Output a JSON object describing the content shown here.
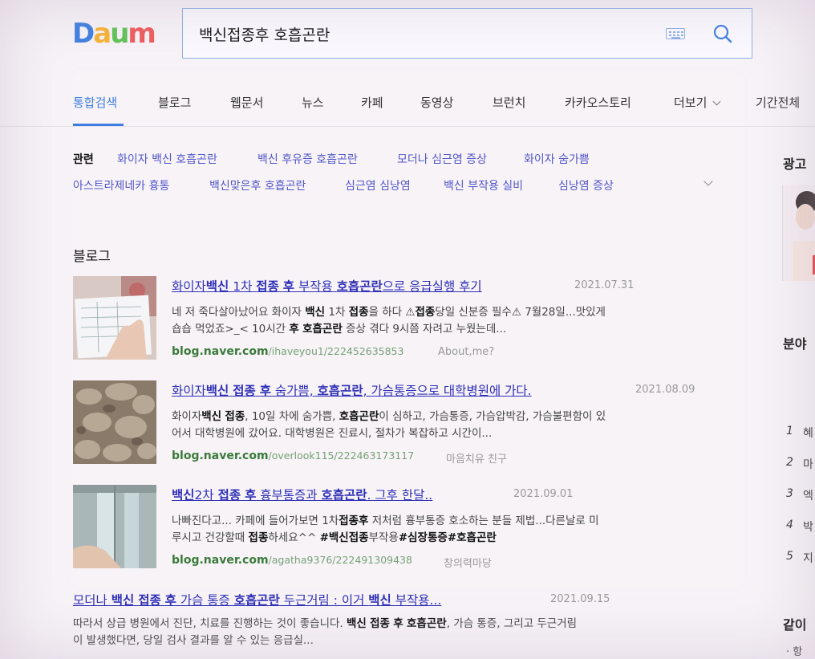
{
  "logo": {
    "letters": [
      "D",
      "a",
      "u",
      "m"
    ],
    "colors": [
      "#3d7ee0",
      "#f7b232",
      "#5fc255",
      "#ef5a5a"
    ]
  },
  "search": {
    "query": "백신접종후 호흡곤란"
  },
  "tabs": [
    "통합검색",
    "블로그",
    "웹문서",
    "뉴스",
    "카페",
    "동영상",
    "브런치",
    "카카오스토리",
    "더보기",
    "기간전체"
  ],
  "related": {
    "label": "관련",
    "row1": [
      "화이자 백신 호흡곤란",
      "백신 후유증 호흡곤란",
      "모더나 심근염 증상",
      "화이자 숨가쁨"
    ],
    "row2": [
      "아스트라제네카 흉통",
      "백신맞은후 호흡곤란",
      "심근염 심낭염",
      "백신 부작용 실비",
      "심낭염 증상"
    ]
  },
  "blog": {
    "section_title": "블로그",
    "results": [
      {
        "title_parts": [
          [
            "화이자",
            false
          ],
          [
            "백신",
            true
          ],
          [
            " 1차 ",
            false
          ],
          [
            "접종",
            true
          ],
          [
            " ",
            false
          ],
          [
            "후",
            true
          ],
          [
            " 부작용 ",
            false
          ],
          [
            "호흡곤란",
            true
          ],
          [
            "으로 응급실행 후기",
            false
          ]
        ],
        "date": "2021.07.31",
        "desc_line1": [
          [
            "네 저 죽다살아났어요 화이자 ",
            false
          ],
          [
            "백신",
            true
          ],
          [
            " 1차 ",
            false
          ],
          [
            "접종",
            true
          ],
          [
            "을 하다 ⚠",
            false
          ],
          [
            "접종",
            true
          ],
          [
            "당일 신분증 필수⚠ 7월28일...맛있게",
            false
          ]
        ],
        "desc_line2": [
          [
            "숍숍 먹었죠>_< 10시간 ",
            false
          ],
          [
            "후",
            true
          ],
          [
            " ",
            false
          ],
          [
            "호흡곤란",
            true
          ],
          [
            " 증상 겪다 9시쯤 자려고 누웠는데...",
            false
          ]
        ],
        "url_domain": "blog.naver.com",
        "url_path": "/ihaveyou1/222452635853",
        "source": "About,me?"
      },
      {
        "title_parts": [
          [
            "화이자",
            false
          ],
          [
            "백신",
            true
          ],
          [
            " ",
            false
          ],
          [
            "접종",
            true
          ],
          [
            " ",
            false
          ],
          [
            "후",
            true
          ],
          [
            " 숨가쁨, ",
            false
          ],
          [
            "호흡곤란",
            true
          ],
          [
            ", 가슴통증으로 대학병원에 가다.",
            false
          ]
        ],
        "date": "2021.08.09",
        "desc_line1": [
          [
            "화이자",
            false
          ],
          [
            "백신",
            true
          ],
          [
            " ",
            false
          ],
          [
            "접종",
            true
          ],
          [
            ", 10일 차에 숨가쁨, ",
            false
          ],
          [
            "호흡곤란",
            true
          ],
          [
            "이 심하고, 가슴통증, 가슴압박감, 가슴불편함이 있",
            false
          ]
        ],
        "desc_line2": [
          [
            "어서 대학병원에 갔어요. 대학병원은 진료시, 절차가 복잡하고 시간이...",
            false
          ]
        ],
        "url_domain": "blog.naver.com",
        "url_path": "/overlook115/222463173117",
        "source": "마음치유 친구"
      },
      {
        "title_parts": [
          [
            "백신",
            true
          ],
          [
            "2차 ",
            false
          ],
          [
            "접종",
            true
          ],
          [
            " ",
            false
          ],
          [
            "후",
            true
          ],
          [
            " 흉부통증과 ",
            false
          ],
          [
            "호흡곤란",
            true
          ],
          [
            ". 그후 한달..",
            false
          ]
        ],
        "date": "2021.09.01",
        "desc_line1": [
          [
            "나빠진다고...   카페에 들어가보면 1차",
            false
          ],
          [
            "접종후",
            true
          ],
          [
            " 저처럼 흉부통증 호소하는 분들 제법...다른날로 미",
            false
          ]
        ],
        "desc_line2": [
          [
            "루시고 건강할때 ",
            false
          ],
          [
            "접종",
            true
          ],
          [
            "하세요^^    ",
            false
          ],
          [
            "#백신접종",
            true
          ],
          [
            "부작용",
            false
          ],
          [
            "#심장통증",
            true
          ],
          [
            "",
            false
          ],
          [
            "#호흡곤란",
            true
          ]
        ],
        "url_domain": "blog.naver.com",
        "url_path": "/agatha9376/222491309438",
        "source": "창의력마당"
      },
      {
        "title_parts": [
          [
            "모더나 ",
            false
          ],
          [
            "백신",
            true
          ],
          [
            " ",
            false
          ],
          [
            "접종",
            true
          ],
          [
            " ",
            false
          ],
          [
            "후",
            true
          ],
          [
            " 가슴 통증 ",
            false
          ],
          [
            "호흡곤란",
            true
          ],
          [
            " 두근거림 : 이거 ",
            false
          ],
          [
            "백신",
            true
          ],
          [
            " 부작용...",
            false
          ]
        ],
        "date": "2021.09.15",
        "desc_line1": [
          [
            "따라서 상급 병원에서 진단, 치료를 진행하는 것이 좋습니다. ",
            false
          ],
          [
            "백신",
            true
          ],
          [
            " ",
            false
          ],
          [
            "접종",
            true
          ],
          [
            " ",
            false
          ],
          [
            "후",
            true
          ],
          [
            " ",
            false
          ],
          [
            "호흡곤란",
            true
          ],
          [
            ", 가슴 통증, 그리고 두근거림",
            false
          ]
        ],
        "desc_line2": [
          [
            "이 발생했다면, 당일 검사 결과를 알 수 있는 응급실...",
            false
          ]
        ]
      }
    ]
  },
  "sidebar": {
    "ad_label": "광고",
    "section2": "분야",
    "rank_numbers": [
      "1",
      "2",
      "3",
      "4",
      "5"
    ],
    "rank_titles": [
      "혜",
      "마",
      "엑",
      "박",
      "지"
    ],
    "section3": "같이",
    "section3_item": "· 항"
  },
  "colors": {
    "accent": "#3e7ee0",
    "link": "#2f2fb8",
    "related": "#5357c9",
    "url": "#3a7a3a"
  }
}
